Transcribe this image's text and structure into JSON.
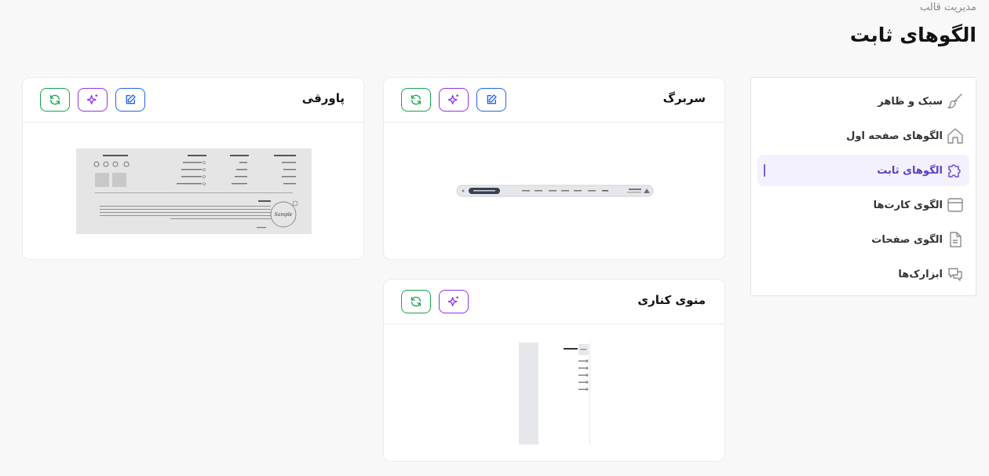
{
  "breadcrumb": "مدیریت قالب",
  "page_title": "الگوهای ثابت",
  "sidebar": {
    "items": [
      {
        "label": "سبک و ظاهر",
        "icon": "brush-icon",
        "active": false
      },
      {
        "label": "الگوهای صفحه اول",
        "icon": "home-icon",
        "active": false
      },
      {
        "label": "الگوهای ثابت",
        "icon": "puzzle-icon",
        "active": true
      },
      {
        "label": "الگوی کارت‌ها",
        "icon": "card-layout-icon",
        "active": false
      },
      {
        "label": "الگوی صفحات",
        "icon": "document-icon",
        "active": false
      },
      {
        "label": "ابزارک‌ها",
        "icon": "chat-bubbles-icon",
        "active": false
      }
    ]
  },
  "cards": {
    "header": {
      "title": "سربرگ"
    },
    "footer": {
      "title": "پاورقی"
    },
    "side_menu": {
      "title": "منوی کناری"
    }
  },
  "colors": {
    "refresh": "#16a34a",
    "ai": "#9333ea",
    "edit": "#2563eb",
    "active_accent": "#7c5cd6"
  },
  "button_icons": [
    "refresh-icon",
    "sparkles-icon",
    "edit-icon"
  ]
}
